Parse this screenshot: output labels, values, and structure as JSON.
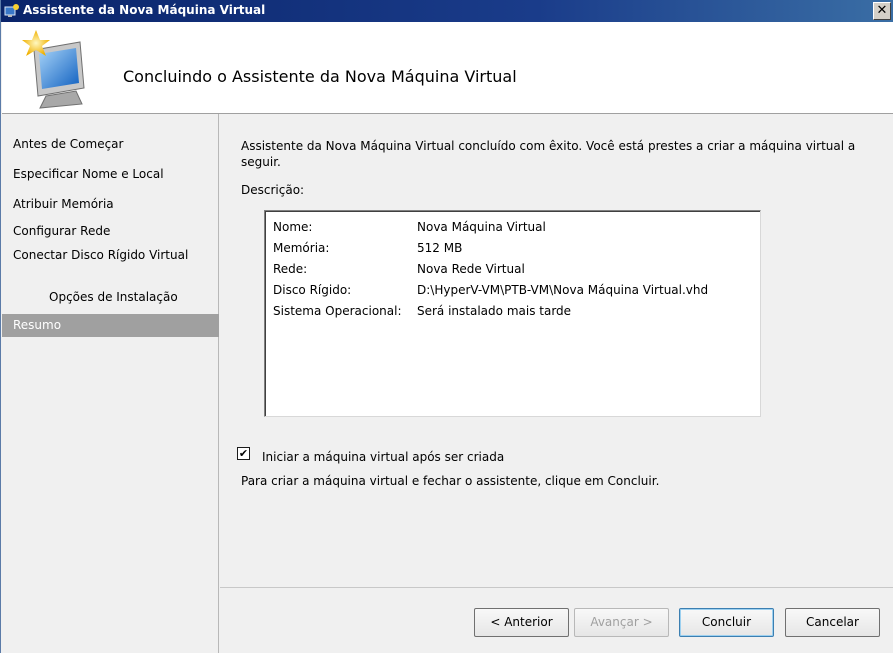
{
  "window": {
    "title": "Assistente da Nova Máquina Virtual",
    "close_glyph": "✕"
  },
  "header": {
    "heading": "Concluindo o Assistente da Nova Máquina Virtual",
    "icon": "wizard-computer-icon"
  },
  "nav": {
    "items": [
      {
        "label": "Antes de Começar"
      },
      {
        "label": "Especificar Nome e Local"
      },
      {
        "label": "Atribuir Memória"
      },
      {
        "label": "Configurar Rede"
      },
      {
        "label": "Conectar Disco Rígido Virtual"
      },
      {
        "label": "Opções de Instalação"
      },
      {
        "label": "Resumo"
      }
    ],
    "active_color": "#a0a0a0"
  },
  "content": {
    "intro": "Assistente da Nova Máquina Virtual concluído com êxito. Você está prestes a criar a máquina virtual a seguir.",
    "description_label": "Descrição:",
    "summary": [
      {
        "key": "Nome:",
        "value": "Nova Máquina Virtual"
      },
      {
        "key": "Memória:",
        "value": "512 MB"
      },
      {
        "key": "Rede:",
        "value": "Nova Rede Virtual"
      },
      {
        "key": "Disco Rígido:",
        "value": "D:\\HyperV-VM\\PTB-VM\\Nova Máquina Virtual.vhd"
      },
      {
        "key": "Sistema Operacional:",
        "value": "Será instalado mais tarde"
      }
    ],
    "start_vm_checkbox": {
      "label": "Iniciar a máquina virtual após ser criada",
      "checked": true,
      "glyph": "✔"
    },
    "finish_text": "Para criar a máquina virtual e fechar o assistente, clique em Concluir."
  },
  "buttons": {
    "previous": "< Anterior",
    "next": "Avançar >",
    "finish": "Concluir",
    "cancel": "Cancelar"
  }
}
